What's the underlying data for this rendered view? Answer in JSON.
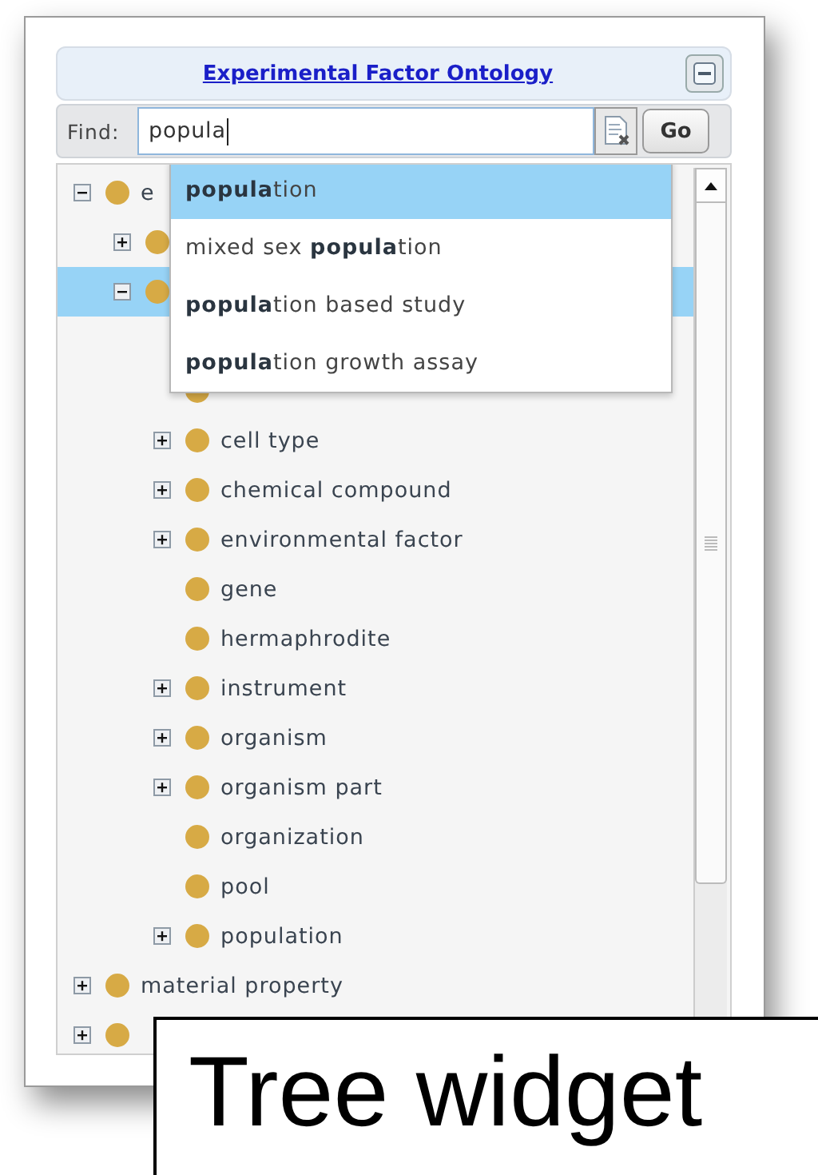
{
  "header": {
    "title": "Experimental Factor Ontology"
  },
  "find": {
    "label": "Find:",
    "value": "popula",
    "go": "Go"
  },
  "suggestions": [
    {
      "text": "**popula**tion",
      "selected": true
    },
    {
      "text": "mixed sex **popula**tion",
      "selected": false
    },
    {
      "text": "**popula**tion based study",
      "selected": false
    },
    {
      "text": "**popula**tion growth assay",
      "selected": false
    }
  ],
  "tree": [
    {
      "kind": "folder",
      "label": "e",
      "expanded": true,
      "selected": false,
      "children": [
        {
          "kind": "folder",
          "expanded": false,
          "selected": false
        },
        {
          "kind": "folder",
          "expanded": true,
          "selected": true,
          "children": [
            {
              "kind": "leaf",
              "selected": false
            },
            {
              "kind": "folder",
              "label": "cell type",
              "expanded": false,
              "selected": false
            },
            {
              "kind": "folder",
              "label": "chemical compound",
              "expanded": false,
              "selected": false
            },
            {
              "kind": "folder",
              "label": "environmental factor",
              "expanded": false,
              "selected": false
            },
            {
              "kind": "leaf",
              "label": "gene",
              "selected": false
            },
            {
              "kind": "leaf",
              "label": "hermaphrodite",
              "selected": false
            },
            {
              "kind": "folder",
              "label": "instrument",
              "expanded": false,
              "selected": false
            },
            {
              "kind": "folder",
              "label": "organism",
              "expanded": false,
              "selected": false
            },
            {
              "kind": "folder",
              "label": "organism part",
              "expanded": false,
              "selected": false
            },
            {
              "kind": "leaf",
              "label": "organization",
              "selected": false
            },
            {
              "kind": "leaf",
              "label": "pool",
              "selected": false
            },
            {
              "kind": "folder",
              "label": "population",
              "expanded": false,
              "selected": false
            }
          ]
        }
      ]
    },
    {
      "kind": "folder",
      "label": "material property",
      "expanded": false,
      "selected": false
    },
    {
      "kind": "folder",
      "expanded": false,
      "selected": false
    }
  ],
  "caption": "Tree widget"
}
